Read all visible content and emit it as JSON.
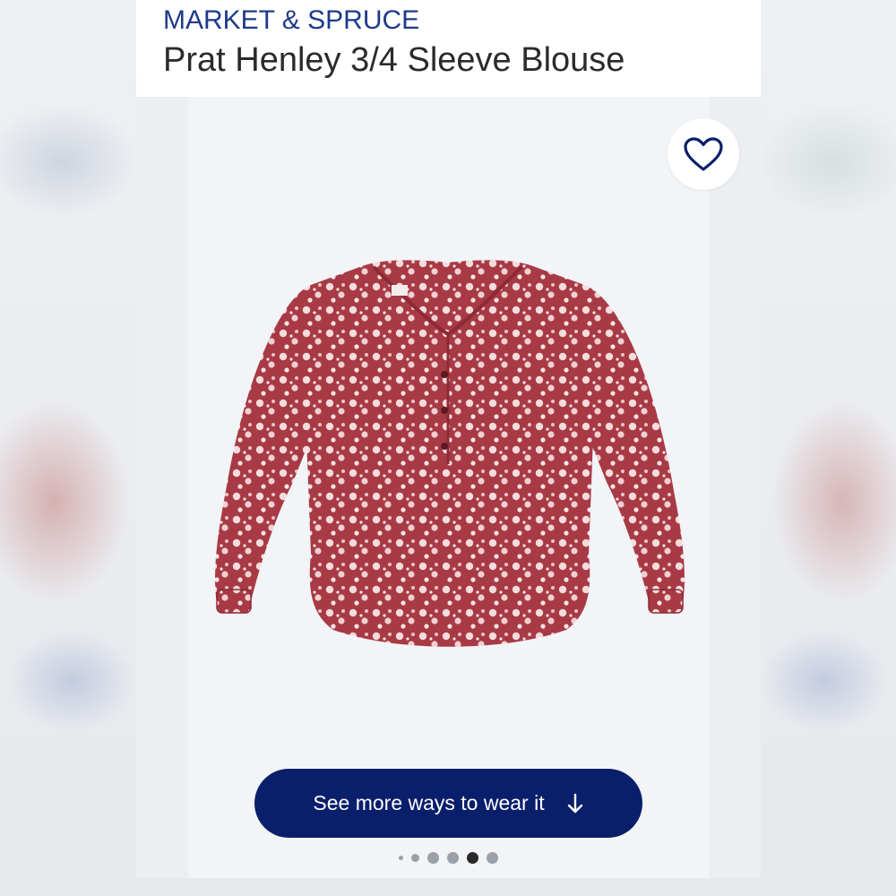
{
  "product": {
    "brand": "MARKET & SPRUCE",
    "title": "Prat Henley 3/4 Sleeve Blouse"
  },
  "actions": {
    "favorite_icon": "heart-outline-icon",
    "see_more_label": "See more ways to wear it",
    "see_more_icon": "arrow-down-icon"
  },
  "carousel": {
    "total_slides": 6,
    "active_index": 4
  },
  "colors": {
    "brand_blue": "#1f3a8a",
    "cta_navy": "#0a1f6b",
    "garment_red": "#a83a45",
    "flower_pink": "#f4dcdc"
  }
}
